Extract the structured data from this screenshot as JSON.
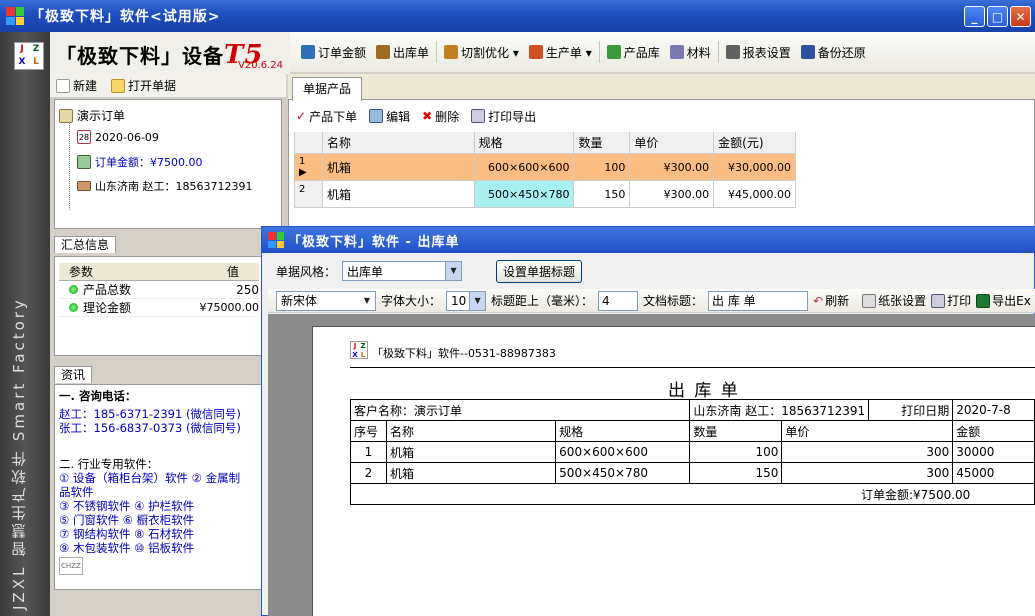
{
  "window": {
    "title": "「极致下料」软件<试用版>",
    "min": "_",
    "max": "□",
    "close": "✕"
  },
  "side_logo": {
    "l1": "J",
    "l2": "Z",
    "l3": "X",
    "l4": "L"
  },
  "side_text": "JZXL 智慧生产软件 Smart Factory",
  "brand": {
    "name": "「极致下料」设备",
    "t5": "T5",
    "version": "V20.6.24"
  },
  "toolbar": [
    {
      "label": "订单金额",
      "icon": "dollar-icon",
      "color": "#2d6fb8"
    },
    {
      "label": "出库单",
      "icon": "forklift-icon",
      "color": "#a06a20"
    },
    {
      "label": "切割优化 ▾",
      "icon": "cut-icon",
      "color": "#c08020"
    },
    {
      "label": "生产单 ▾",
      "icon": "production-icon",
      "color": "#d05020"
    },
    {
      "label": "产品库",
      "icon": "product-icon",
      "color": "#3a9a3a"
    },
    {
      "label": "材料",
      "icon": "material-icon",
      "color": "#7a7ab0"
    },
    {
      "label": "报表设置",
      "icon": "report-icon",
      "color": "#606060"
    },
    {
      "label": "备份还原",
      "icon": "backup-icon",
      "color": "#3050a0"
    }
  ],
  "left_toolbar": {
    "new": "新建",
    "open": "打开单据"
  },
  "tree": {
    "root": "演示订单",
    "date": "2020-06-09",
    "date_icon": "28",
    "amount": "订单金额：¥7500.00",
    "customer": "山东济南 赵工：18563712391"
  },
  "summary": {
    "tab": "汇总信息",
    "col_param": "参数",
    "col_value": "值",
    "rows": [
      {
        "name": "产品总数",
        "value": "250"
      },
      {
        "name": "理论金额",
        "value": "¥75000.00"
      }
    ]
  },
  "info": {
    "tab": "资讯",
    "h1": "一. 咨询电话：",
    "p1": "赵工：185-6371-2391 (微信同号)",
    "p2": "张工：156-6837-0373 (微信同号)",
    "h2": "二. 行业专用软件：",
    "s1": "① 设备（箱柜台架）软件 ② 金属制",
    "s1b": "品软件",
    "s2": "③ 不锈钢软件 ④ 护栏软件",
    "s3": "⑤ 门窗软件 ⑥ 橱衣柜软件",
    "s4": "⑦ 钢结构软件 ⑧ 石材软件",
    "s5": "⑨ 木包装软件 ⑩ 铝板软件",
    "logo": "CHZZ"
  },
  "doc": {
    "tab": "单据产品",
    "tools": {
      "order": "产品下单",
      "edit": "编辑",
      "delete": "删除",
      "print": "打印导出"
    },
    "headers": [
      "名称",
      "规格",
      "数量",
      "单价",
      "金额(元)"
    ],
    "rows": [
      {
        "no": "1",
        "name": "机箱",
        "spec": "600×600×600",
        "qty": "100",
        "price": "¥300.00",
        "amount": "¥30,000.00"
      },
      {
        "no": "2",
        "name": "机箱",
        "spec": "500×450×780",
        "qty": "150",
        "price": "¥300.00",
        "amount": "¥45,000.00"
      }
    ]
  },
  "child": {
    "title": "「极致下料」软件 - 出库单",
    "style_label": "单据风格：",
    "style_value": "出库单",
    "set_title_btn": "设置单据标题",
    "font": "新宋体",
    "font_size_label": "字体大小：",
    "font_size": "10",
    "title_dist_label": "标题距上（毫米）：",
    "title_dist": "4",
    "doc_title_label": "文档标题：",
    "doc_title": "出 库 单",
    "refresh": "刷新",
    "paper": "纸张设置",
    "print": "打印",
    "export": "导出Ex"
  },
  "print": {
    "header": "「极致下料」软件--0531-88987383",
    "title": "出 库 单",
    "customer": "客户名称：演示订单",
    "contact": "山东济南 赵工：18563712391",
    "date_label": "打印日期",
    "date": "2020-7-8",
    "cols": [
      "序号",
      "名称",
      "规格",
      "数量",
      "单价",
      "金额"
    ],
    "rows": [
      {
        "no": "1",
        "name": "机箱",
        "spec": "600×600×600",
        "qty": "100",
        "price": "300",
        "amount": "30000"
      },
      {
        "no": "2",
        "name": "机箱",
        "spec": "500×450×780",
        "qty": "150",
        "price": "300",
        "amount": "45000"
      }
    ],
    "total": "订单金额:¥7500.00"
  }
}
